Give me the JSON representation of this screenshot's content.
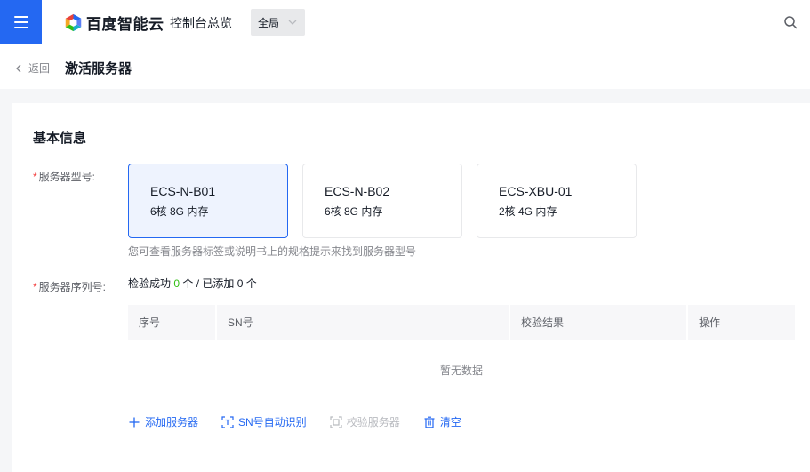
{
  "topbar": {
    "logo_text": "百度智能云",
    "console_title": "控制台总览",
    "region": "全局"
  },
  "page": {
    "back_label": "返回",
    "title": "激活服务器"
  },
  "form": {
    "section_title": "基本信息",
    "model_label": "服务器型号:",
    "models": [
      {
        "name": "ECS-N-B01",
        "spec": "6核 8G 内存",
        "selected": true
      },
      {
        "name": "ECS-N-B02",
        "spec": "6核 8G 内存",
        "selected": false
      },
      {
        "name": "ECS-XBU-01",
        "spec": "2核 4G 内存",
        "selected": false
      }
    ],
    "model_hint": "您可查看服务器标签或说明书上的规格提示来找到服务器型号",
    "serial_label": "服务器序列号:",
    "verify": {
      "prefix": "检验成功 ",
      "success_count": "0",
      "middle": " 个 / 已添加 ",
      "added_count": "0",
      "suffix": " 个"
    },
    "table": {
      "columns": [
        "序号",
        "SN号",
        "校验结果",
        "操作"
      ],
      "empty_text": "暂无数据"
    },
    "actions": {
      "add": "添加服务器",
      "auto_sn": "SN号自动识别",
      "verify": "校验服务器",
      "clear": "清空"
    }
  },
  "colors": {
    "primary": "#2468f2",
    "success": "#30bf13",
    "required": "#f33e3e"
  }
}
